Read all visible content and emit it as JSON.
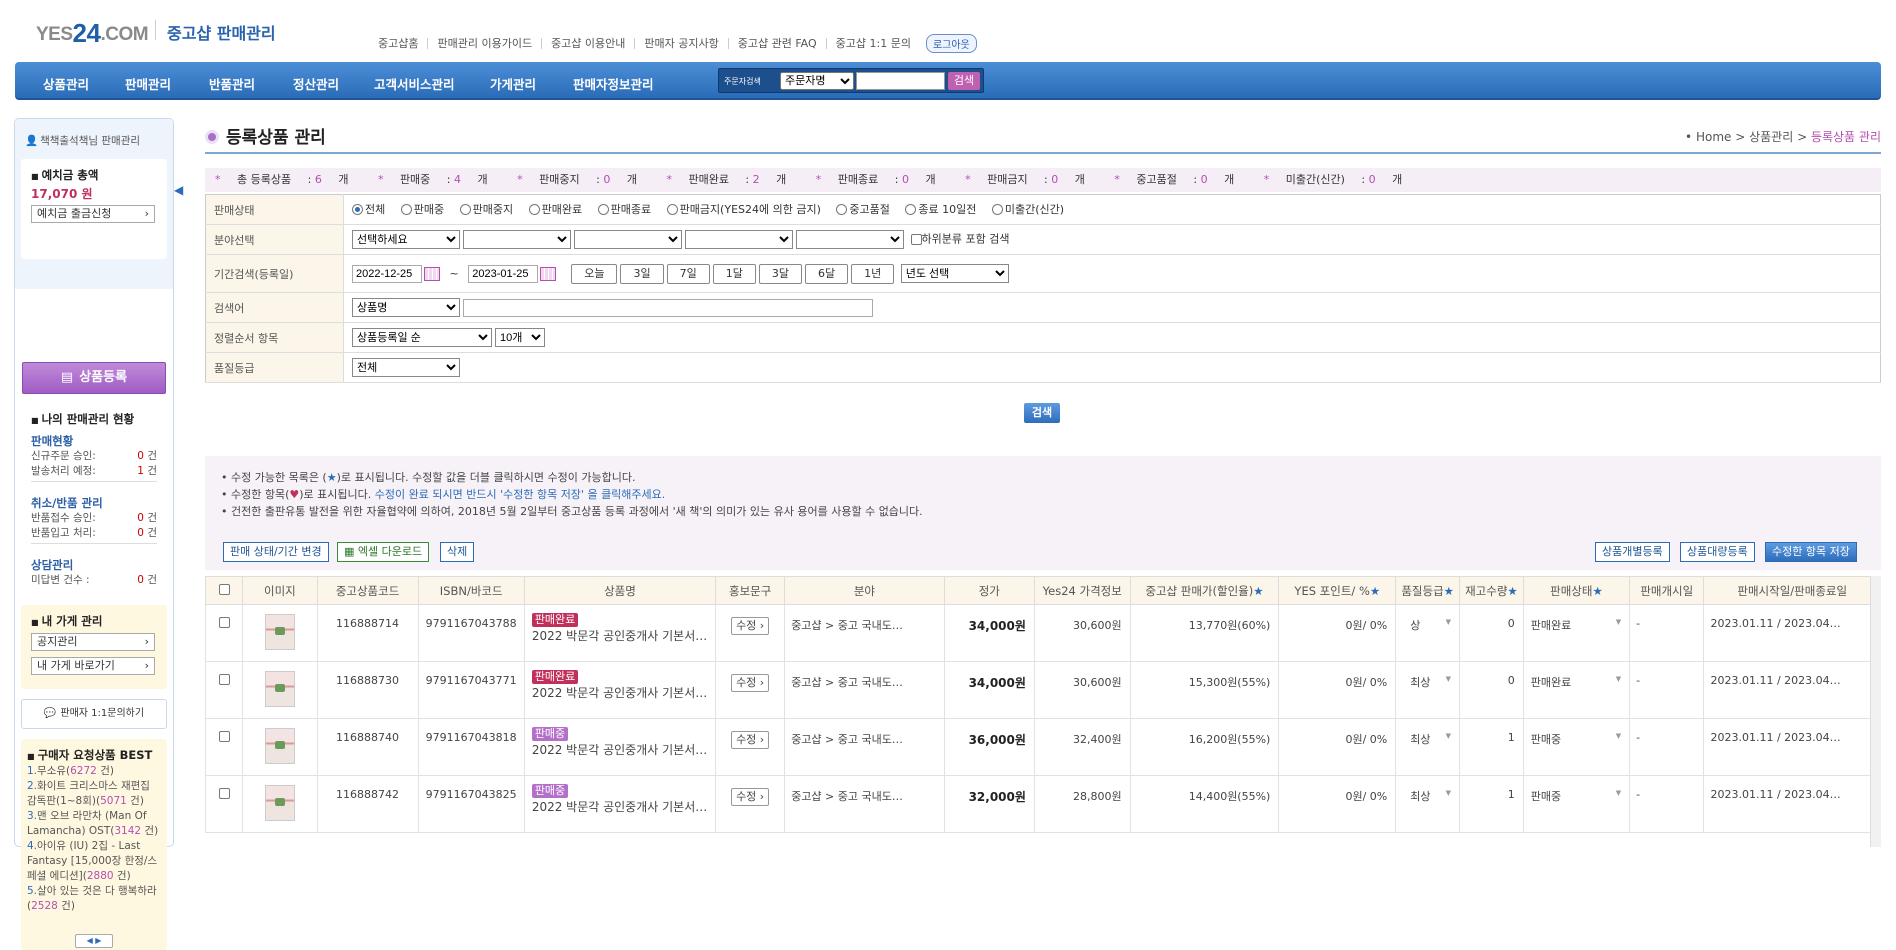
{
  "header": {
    "logo_left": "YES",
    "logo_num": "24",
    "logo_right": ".COM",
    "subtitle": "중고샵 판매관리",
    "links": [
      "중고샵홈",
      "판매관리 이용가이드",
      "중고샵 이용안내",
      "판매자 공지사항",
      "중고샵 관련 FAQ",
      "중고샵 1:1 문의"
    ],
    "logout": "로그아웃"
  },
  "gnb": {
    "items": [
      "상품관리",
      "판매관리",
      "반품관리",
      "정산관리",
      "고객서비스관리",
      "가게관리",
      "판매자정보관리"
    ],
    "search_label": "주문자검색",
    "search_select": "주문자명",
    "search_button": "검색"
  },
  "sidebar": {
    "user": "책책출석책님 판매관리",
    "deposit_title": "예치금 총액",
    "deposit_amount": "17,070 원",
    "deposit_button": "예치금 출금신청",
    "register_button": "상품등록",
    "status_title": "나의 판매관리 현황",
    "sales_head": "판매현황",
    "sales_rows": [
      {
        "label": "신규주문 승인:",
        "count": "0",
        "unit": "건"
      },
      {
        "label": "발송처리 예정:",
        "count": "1",
        "unit": "건"
      }
    ],
    "cancel_head": "취소/반품 관리",
    "cancel_rows": [
      {
        "label": "반품접수 승인:",
        "count": "0",
        "unit": "건"
      },
      {
        "label": "반품입고 처리:",
        "count": "0",
        "unit": "건"
      }
    ],
    "consult_head": "상담관리",
    "consult_rows": [
      {
        "label": "미답변 건수 :",
        "count": "0",
        "unit": "건"
      }
    ],
    "store_title": "내 가게 관리",
    "store_buttons": [
      "공지관리",
      "내 가게 바로가기"
    ],
    "inquiry": "판매자 1:1문의하기",
    "best_title": "구매자 요청상품 BEST",
    "best_items": [
      {
        "n": "1.",
        "title": "무소유",
        "count": "6272"
      },
      {
        "n": "2.",
        "title": "화이트 크리스마스 재편집 감독판(1~8회)",
        "count": "5071"
      },
      {
        "n": "3.",
        "title": "맨 오브 라만차 (Man Of Lamancha) OST",
        "count": "3142"
      },
      {
        "n": "4.",
        "title": "아이유 (IU) 2집 - Last Fantasy [15,000장 한정/스페셜 에디션]",
        "count": "2880"
      },
      {
        "n": "5.",
        "title": "살아 있는 것은 다 행복하라",
        "count": "2528"
      }
    ]
  },
  "main": {
    "title": "등록상품 관리",
    "crumb_home": "Home",
    "crumb_mid": "상품관리",
    "crumb_cur": "등록상품 관리",
    "summary": [
      {
        "label": "총 등록상품",
        "val": "6",
        "unit": "개"
      },
      {
        "label": "판매중",
        "val": "4",
        "unit": "개"
      },
      {
        "label": "판매중지",
        "val": "0",
        "unit": "개"
      },
      {
        "label": "판매완료",
        "val": "2",
        "unit": "개"
      },
      {
        "label": "판매종료",
        "val": "0",
        "unit": "개"
      },
      {
        "label": "판매금지",
        "val": "0",
        "unit": "개"
      },
      {
        "label": "중고품절",
        "val": "0",
        "unit": "개"
      },
      {
        "label": "미출간(신간)",
        "val": "0",
        "unit": "개"
      }
    ],
    "filter": {
      "status_label": "판매상태",
      "status_options": [
        "전체",
        "판매중",
        "판매중지",
        "판매완료",
        "판매종료",
        "판매금지(YES24에 의한 금지)",
        "중고품절",
        "종료 10일전",
        "미출간(신간)"
      ],
      "category_label": "분야선택",
      "category_first": "선택하세요",
      "category_sub": "하위분류 포함 검색",
      "period_label": "기간검색(등록일)",
      "date_from": "2022-12-25",
      "date_to": "2023-01-25",
      "period_buttons": [
        "오늘",
        "3일",
        "7일",
        "1달",
        "3달",
        "6달",
        "1년"
      ],
      "year_select": "년도 선택",
      "keyword_label": "검색어",
      "keyword_select": "상품명",
      "sort_label": "정렬순서 항목",
      "sort_select": "상품등록일 순",
      "count_select": "10개",
      "grade_label": "품질등급",
      "grade_select": "전체",
      "search_button": "검색"
    },
    "notice": {
      "line1a": "• 수정 가능한 목록은 (",
      "line1b": ")로 표시됩니다. 수정할 값을 더블 클릭하시면 수정이 가능합니다.",
      "line2a": "• 수정한 항목(",
      "line2b": ")로 표시됩니다. ",
      "line2c": "수정이 완료 되시면 반드시 '수정한 항목 저장' 을 클릭해주세요.",
      "line3": "• 건전한 출판유통 발전을 위한 자율협약에 의하여, 2018년 5월 2일부터 중고상품 등록 과정에서 '새 책'의 의미가 있는 유사 용어를 사용할 수 없습니다.",
      "btn_status": "판매 상태/기간 변경",
      "btn_excel": "엑셀 다운로드",
      "btn_delete": "삭제",
      "btn_single": "상품개별등록",
      "btn_bulk": "상품대량등록",
      "btn_save": "수정한 항목 저장"
    },
    "columns": [
      "이미지",
      "중고상품코드",
      "ISBN/바코드",
      "상품명",
      "홍보문구",
      "분야",
      "정가",
      "Yes24 가격정보",
      "중고샵 판매가(할인율)",
      "YES 포인트/ %",
      "품질등급",
      "재고수량",
      "판매상태",
      "판매개시일",
      "판매시작일/판매종료일"
    ],
    "edit_label": "수정",
    "rows": [
      {
        "code": "116888714",
        "isbn": "9791167043788",
        "badge": "판매완료",
        "badge_color": "#c0305a",
        "name": "2022 박문각 공인중개사 기본서…",
        "category": "중고샵 > 중고 국내도…",
        "list_price": "34,000원",
        "yes24_price": "30,600원",
        "sale_price": "13,770원(60%)",
        "point": "0원/ 0%",
        "grade": "상",
        "stock": "0",
        "status": "판매완료",
        "start": "-",
        "period": "2023.01.11 / 2023.04…"
      },
      {
        "code": "116888730",
        "isbn": "9791167043771",
        "badge": "판매완료",
        "badge_color": "#c0305a",
        "name": "2022 박문각 공인중개사 기본서…",
        "category": "중고샵 > 중고 국내도…",
        "list_price": "34,000원",
        "yes24_price": "30,600원",
        "sale_price": "15,300원(55%)",
        "point": "0원/ 0%",
        "grade": "최상",
        "stock": "0",
        "status": "판매완료",
        "start": "-",
        "period": "2023.01.11 / 2023.04…"
      },
      {
        "code": "116888740",
        "isbn": "9791167043818",
        "badge": "판매중",
        "badge_color": "#b46fc9",
        "name": "2022 박문각 공인중개사 기본서…",
        "category": "중고샵 > 중고 국내도…",
        "list_price": "36,000원",
        "yes24_price": "32,400원",
        "sale_price": "16,200원(55%)",
        "point": "0원/ 0%",
        "grade": "최상",
        "stock": "1",
        "status": "판매중",
        "start": "-",
        "period": "2023.01.11 / 2023.04…"
      },
      {
        "code": "116888742",
        "isbn": "9791167043825",
        "badge": "판매중",
        "badge_color": "#b46fc9",
        "name": "2022 박문각 공인중개사 기본서…",
        "category": "중고샵 > 중고 국내도…",
        "list_price": "32,000원",
        "yes24_price": "28,800원",
        "sale_price": "14,400원(55%)",
        "point": "0원/ 0%",
        "grade": "최상",
        "stock": "1",
        "status": "판매중",
        "start": "-",
        "period": "2023.01.11 / 2023.04…"
      }
    ]
  }
}
